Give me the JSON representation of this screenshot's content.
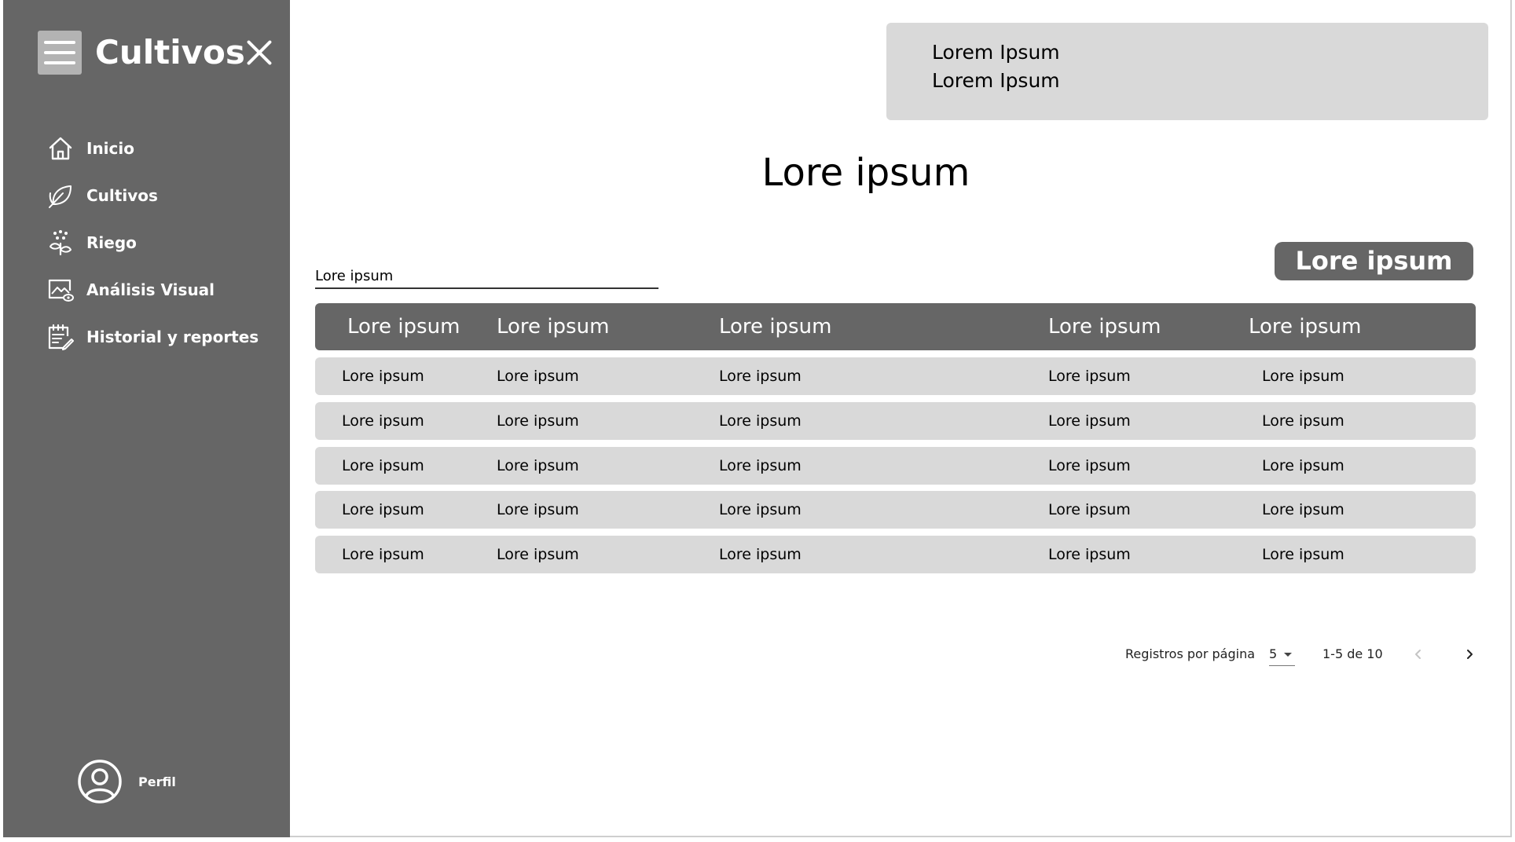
{
  "sidebar": {
    "app_title": "Cultivos",
    "menu_icon": "hamburger-menu-icon",
    "close_icon": "close-icon",
    "items": [
      {
        "label": "Inicio",
        "icon": "home-icon"
      },
      {
        "label": "Cultivos",
        "icon": "leaf-icon"
      },
      {
        "label": "Riego",
        "icon": "watering-plant-icon"
      },
      {
        "label": "Análisis Visual",
        "icon": "image-analysis-icon"
      },
      {
        "label": "Historial y reportes",
        "icon": "report-icon"
      }
    ],
    "profile": {
      "label": "Perfil",
      "icon": "user-avatar-icon"
    }
  },
  "info_box": {
    "line1": "Lorem Ipsum",
    "line2": "Lorem Ipsum"
  },
  "main": {
    "title": "Lore ipsum",
    "search_value": "Lore ipsum",
    "action_button": "Lore ipsum"
  },
  "table": {
    "headers": [
      "Lore ipsum",
      "Lore ipsum",
      "Lore ipsum",
      "Lore ipsum",
      "Lore ipsum"
    ],
    "rows": [
      [
        "Lore ipsum",
        "Lore ipsum",
        "Lore ipsum",
        "Lore ipsum",
        "Lore ipsum"
      ],
      [
        "Lore ipsum",
        "Lore ipsum",
        "Lore ipsum",
        "Lore ipsum",
        "Lore ipsum"
      ],
      [
        "Lore ipsum",
        "Lore ipsum",
        "Lore ipsum",
        "Lore ipsum",
        "Lore ipsum"
      ],
      [
        "Lore ipsum",
        "Lore ipsum",
        "Lore ipsum",
        "Lore ipsum",
        "Lore ipsum"
      ],
      [
        "Lore ipsum",
        "Lore ipsum",
        "Lore ipsum",
        "Lore ipsum",
        "Lore ipsum"
      ]
    ]
  },
  "pagination": {
    "rows_per_page_label": "Registros por página",
    "rows_per_page_value": "5",
    "range": "1-5 de 10",
    "prev_icon": "chevron-left-icon",
    "next_icon": "chevron-right-icon"
  },
  "colors": {
    "sidebar_bg": "#666666",
    "panel_gray": "#d9d9d9",
    "menu_button_bg": "#b3b3b3",
    "text_light": "#ffffff"
  }
}
